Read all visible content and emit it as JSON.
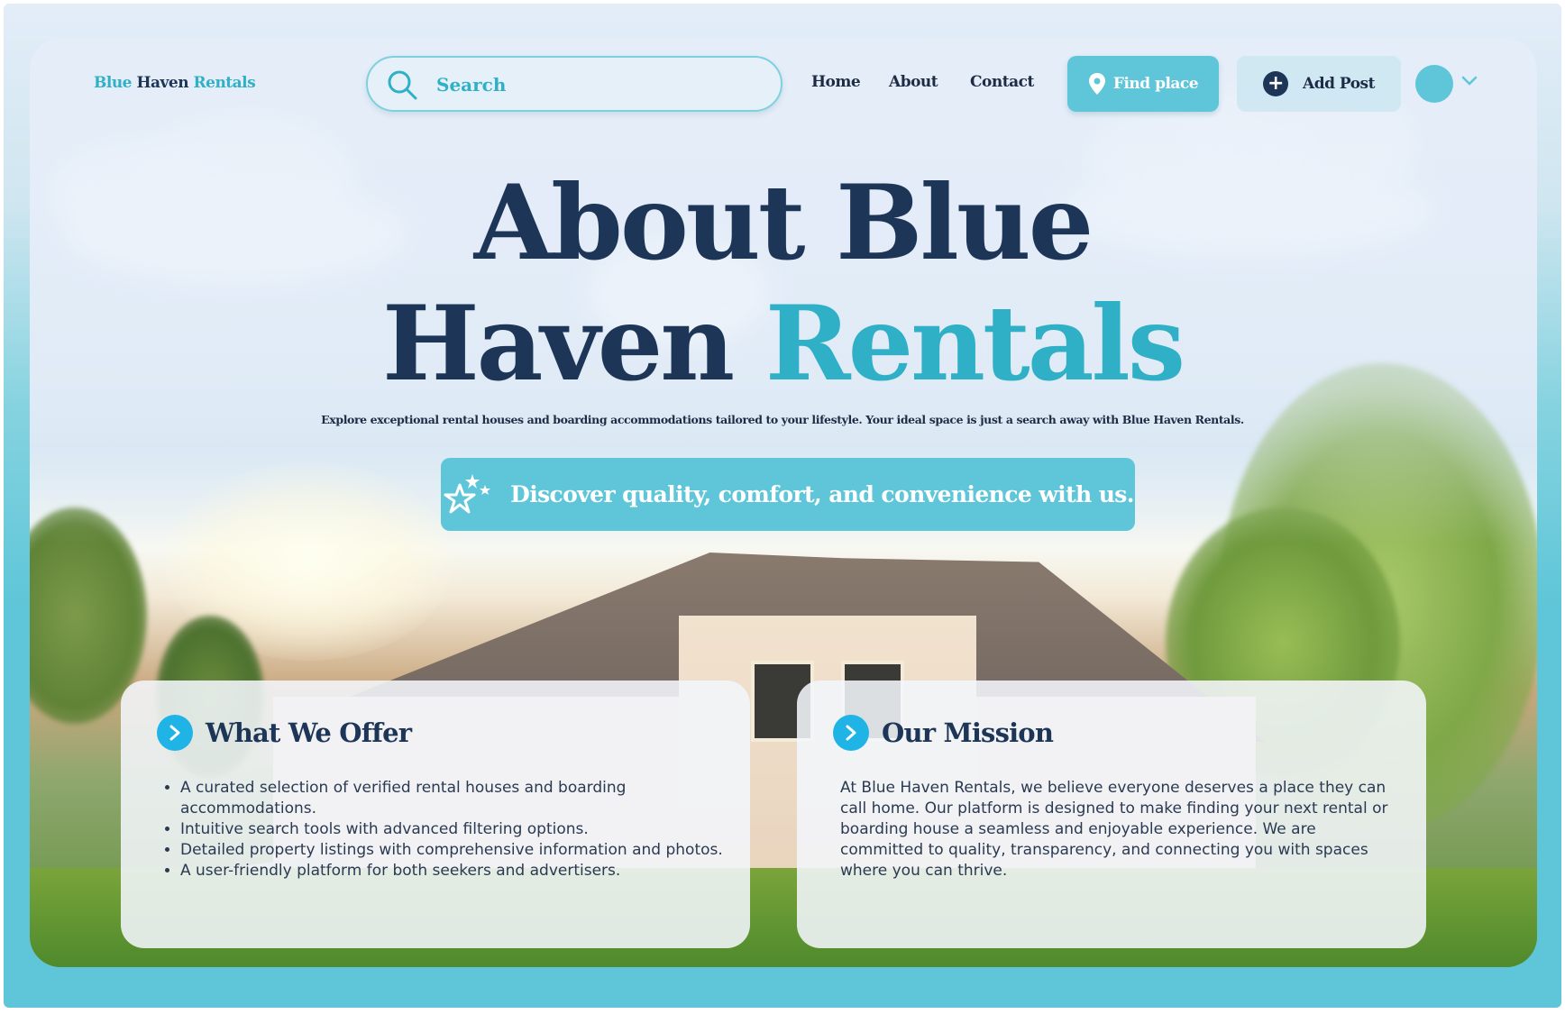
{
  "header": {
    "logo": {
      "part1": "Blue",
      "part2": "Haven",
      "part3": "Rentals"
    },
    "search": {
      "placeholder": "Search"
    },
    "nav": [
      {
        "label": "Home"
      },
      {
        "label": "About"
      },
      {
        "label": "Contact"
      }
    ],
    "find_place_label": "Find place",
    "add_post_label": "Add Post"
  },
  "hero": {
    "title_line1": "About Blue",
    "title_line2_part1": "Haven ",
    "title_line2_accent": "Rentals",
    "subtitle": "Explore exceptional rental houses and boarding accommodations tailored to your lifestyle. Your ideal space is just a search away with Blue Haven Rentals.",
    "banner_text": "Discover quality, comfort, and convenience with us."
  },
  "cards": {
    "offer": {
      "title": "What We Offer",
      "items": [
        "A curated selection of verified rental houses and boarding accommodations.",
        "Intuitive search tools with advanced filtering options.",
        "Detailed property listings with comprehensive information and photos.",
        "A user-friendly platform for both seekers and advertisers."
      ]
    },
    "mission": {
      "title": "Our Mission",
      "text": "At Blue Haven Rentals, we believe everyone deserves a place they can call home. Our platform is designed to make finding your next rental or boarding house a seamless and enjoyable experience. We are committed to quality, transparency, and connecting you with spaces where you can thrive."
    }
  },
  "colors": {
    "accent": "#5ec6d8",
    "accent_text": "#2fb0c6",
    "navy": "#1d3557",
    "icon_blue": "#1fb3e6"
  },
  "icons": [
    "search-icon",
    "location-pin-icon",
    "plus-icon",
    "chevron-down-icon",
    "stars-icon",
    "chevron-right-icon"
  ]
}
